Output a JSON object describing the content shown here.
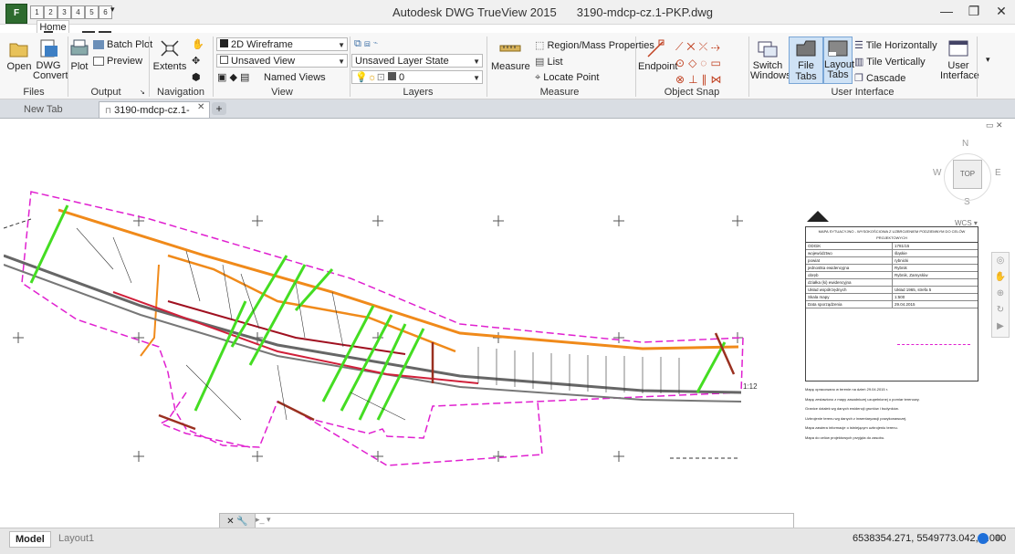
{
  "app": {
    "title": "Autodesk DWG TrueView 2015",
    "filename": "3190-mdcp-cz.1-PKP.dwg"
  },
  "qat_keytips": [
    "1",
    "2",
    "3",
    "4",
    "5",
    "6"
  ],
  "ribbon_tab": {
    "home": "Home",
    "keytip_h": "H",
    "keytip_x2": "X2",
    "keytip_x3": "X3"
  },
  "files": {
    "open": "Open",
    "dwg_convert": "DWG Convert",
    "title": "Files"
  },
  "output": {
    "plot": "Plot",
    "batch_plot": "Batch Plot",
    "preview": "Preview",
    "title": "Output"
  },
  "navigation": {
    "extents": "Extents",
    "title": "Navigation"
  },
  "view": {
    "visual_style": "2D Wireframe",
    "saved_view": "Unsaved View",
    "named_views": "Named Views",
    "title": "View"
  },
  "layers": {
    "layer_state": "Unsaved Layer State",
    "current_layer": "0",
    "title": "Layers"
  },
  "measure": {
    "measure": "Measure",
    "region_mass": "Region/Mass Properties",
    "list": "List",
    "locate_point": "Locate Point",
    "title": "Measure"
  },
  "osnap": {
    "endpoint": "Endpoint",
    "title": "Object Snap"
  },
  "ui": {
    "switch_windows": "Switch Windows",
    "file_tabs": "File Tabs",
    "layout_tabs": "Layout Tabs",
    "tile_h": "Tile Horizontally",
    "tile_v": "Tile Vertically",
    "cascade": "Cascade",
    "user_interface": "User Interface",
    "title": "User Interface"
  },
  "doc_tabs": {
    "new_tab": "New Tab",
    "active": "3190-mdcp-cz.1-PKP"
  },
  "viewcube": {
    "n": "N",
    "e": "E",
    "w": "W",
    "s": "S",
    "top": "TOP",
    "wcs": "WCS"
  },
  "legend": {
    "title": "MAPA SYTUACYJNO - WYSOKOŚCIOWA Z UZBROJENIEM PODZIEMNYM DO CELÓW PROJEKTOWYCH",
    "rows": [
      [
        "ODGiK",
        "1781/15"
      ],
      [
        "województwo",
        "śląskie"
      ],
      [
        "powiat",
        "rybnicki"
      ],
      [
        "jednostka ewidencyjna",
        "Rybnik"
      ],
      [
        "obręb",
        "Rybnik, Zamysłów"
      ],
      [
        "działka (ki) ewidencyjna",
        ""
      ],
      [
        "Układ współrzędnych",
        "Układ 1965, strefa 5"
      ],
      [
        "Skala mapy",
        "1:500"
      ],
      [
        "Data sporządzenia",
        "29.04.2015"
      ]
    ],
    "notes": [
      "Mapę opracowano w terenie na dzień 29.04.2015 r.",
      "Mapę zestawiono z mapy zasadniczej uzupełnionej o pomiar terenowy.",
      "Granice działek wg danych ewidencji gruntów i budynków.",
      "Uzbrojenie terenu wg danych z inwentaryzacji powykonawczej.",
      "Mapa zawiera informacje o istniejącym uzbrojeniu terenu.",
      "Mapa do celów projektowych przyjęta do zasobu."
    ]
  },
  "drawing": {
    "scale_label": "1:12"
  },
  "layout_tabs": {
    "model": "Model",
    "layout1": "Layout1"
  },
  "status": {
    "coords": "6538354.271, 5549773.042, 0.000"
  }
}
